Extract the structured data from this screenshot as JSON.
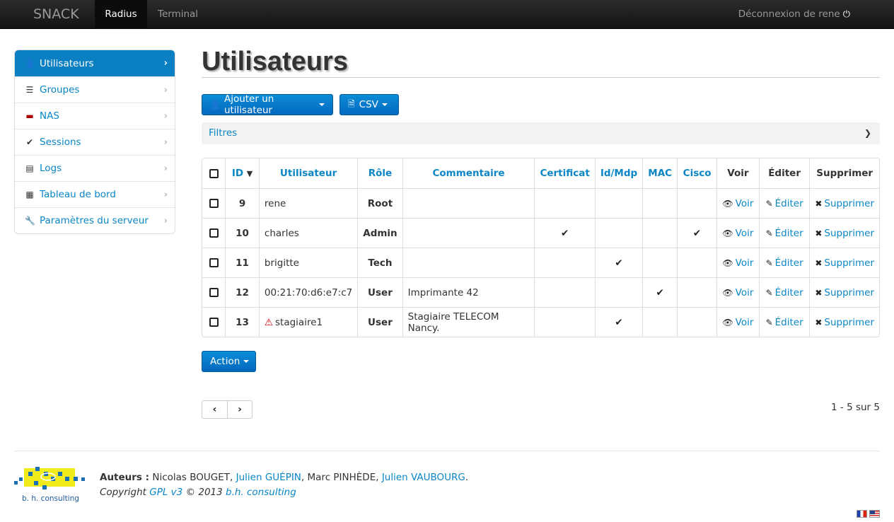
{
  "topbar": {
    "brand": "SNACK",
    "nav": [
      "Radius",
      "Terminal"
    ],
    "logout": "Déconnexion de rene"
  },
  "sidebar": {
    "items": [
      {
        "label": "Utilisateurs",
        "icon": "user-icon",
        "active": true
      },
      {
        "label": "Groupes",
        "icon": "list-icon"
      },
      {
        "label": "NAS",
        "icon": "nas-icon"
      },
      {
        "label": "Sessions",
        "icon": "check-icon"
      },
      {
        "label": "Logs",
        "icon": "log-icon"
      },
      {
        "label": "Tableau de bord",
        "icon": "dashboard-icon"
      },
      {
        "label": "Paramètres du serveur",
        "icon": "wrench-icon"
      }
    ]
  },
  "main": {
    "title": "Utilisateurs",
    "add_user_label": "Ajouter un utilisateur",
    "csv_label": "CSV",
    "filters_label": "Filtres",
    "action_label": "Action",
    "count": "1 - 5 sur 5"
  },
  "table": {
    "headers": [
      "ID",
      "Utilisateur",
      "Rôle",
      "Commentaire",
      "Certificat",
      "Id/Mdp",
      "MAC",
      "Cisco",
      "Voir",
      "Éditer",
      "Supprimer"
    ],
    "rows": [
      {
        "id": "9",
        "user": "rene",
        "role": "Root",
        "comment": "",
        "cert": "",
        "idmdp": "",
        "mac": "",
        "cisco": "",
        "warn": false
      },
      {
        "id": "10",
        "user": "charles",
        "role": "Admin",
        "comment": "",
        "cert": "✔",
        "idmdp": "",
        "mac": "",
        "cisco": "✔",
        "warn": false
      },
      {
        "id": "11",
        "user": "brigitte",
        "role": "Tech",
        "comment": "",
        "cert": "",
        "idmdp": "✔",
        "mac": "",
        "cisco": "",
        "warn": false
      },
      {
        "id": "12",
        "user": "00:21:70:d6:e7:c7",
        "role": "User",
        "comment": "Imprimante 42",
        "cert": "",
        "idmdp": "",
        "mac": "✔",
        "cisco": "",
        "warn": false
      },
      {
        "id": "13",
        "user": "stagiaire1",
        "role": "User",
        "comment": "Stagiaire TELECOM Nancy.",
        "cert": "",
        "idmdp": "✔",
        "mac": "",
        "cisco": "",
        "warn": true
      }
    ],
    "view_label": "Voir",
    "edit_label": "Éditer",
    "delete_label": "Supprimer"
  },
  "footer": {
    "authors_label": "Auteurs :",
    "author1": "Nicolas BOUGET",
    "author2": "Julien GUÉPIN",
    "author3": "Marc PINHÈDE",
    "author4": "Julien VAUBOURG",
    "copyright_prefix": "Copyright",
    "license": "GPL v3",
    "copyright_year": "© 2013",
    "company": "b.h. consulting",
    "logo_text": "b. h. consulting"
  },
  "colors": {
    "accent": "#0a7fc2",
    "link": "#0a86c6",
    "logo_yellow": "#f3ec1c",
    "logo_blue": "#1a6fb5"
  }
}
